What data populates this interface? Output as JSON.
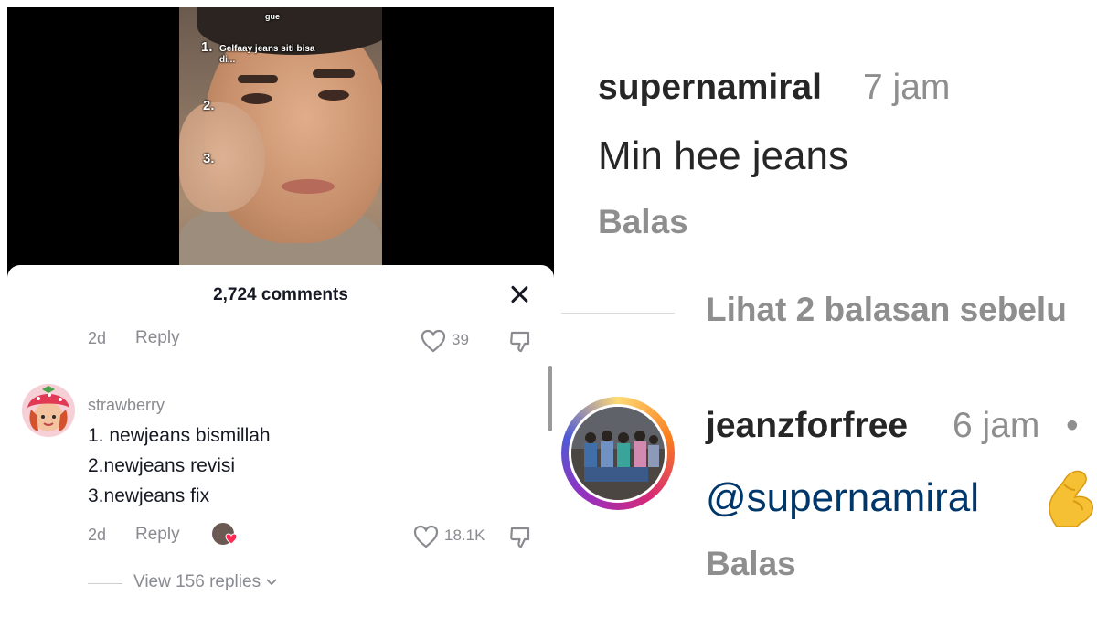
{
  "tiktok": {
    "video": {
      "overlay_top": "gue",
      "overlay_number_1": "1.",
      "overlay_item_1": "Gelfaay jeans siti bisa di...",
      "overlay_number_2": "2.",
      "overlay_number_3": "3."
    },
    "comments_header": "2,724 comments",
    "previous_comment": {
      "age": "2d",
      "reply_label": "Reply",
      "likes": "39"
    },
    "comment": {
      "username": "strawberry",
      "lines": [
        "1. newjeans bismillah",
        "2.newjeans revisi",
        "3.newjeans fix"
      ],
      "age": "2d",
      "reply_label": "Reply",
      "likes": "18.1K",
      "view_replies": "View 156 replies"
    }
  },
  "instagram": {
    "comment": {
      "username": "supernamiral",
      "time": "7 jam",
      "text": "Min hee jeans",
      "reply_label": "Balas"
    },
    "view_previous": "Lihat 2 balasan sebelu",
    "reply": {
      "username": "jeanzforfree",
      "time": "6 jam",
      "separator": "•",
      "mention": "@supernamiral",
      "emoji": "pinched-fingers-emoji",
      "reply_label": "Balas"
    }
  },
  "colors": {
    "tiktok_text": "#161823",
    "tiktok_muted": "#8a8b91",
    "ig_text": "#262626",
    "ig_muted": "#8e8e8e",
    "ig_mention": "#00376b"
  }
}
